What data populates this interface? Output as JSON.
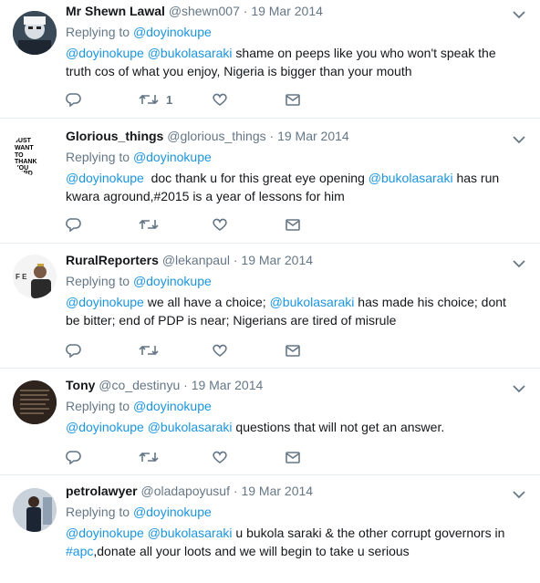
{
  "replying_prefix": "Replying to",
  "tweets": [
    {
      "name": "Mr Shewn Lawal",
      "handle": "@shewn007",
      "sep": "·",
      "date": "19 Mar 2014",
      "replying_to": "@doyinokupe",
      "parts": [
        {
          "t": "@doyinokupe",
          "k": "mention"
        },
        {
          "t": " ",
          "k": "text"
        },
        {
          "t": "@bukolasaraki",
          "k": "mention"
        },
        {
          "t": " shame on peeps like you who won't speak the truth cos of what you enjoy, Nigeria is bigger than your mouth",
          "k": "text"
        }
      ],
      "retweet_count": "1"
    },
    {
      "name": "Glorious_things",
      "handle": "@glorious_things",
      "sep": "·",
      "date": "19 Mar 2014",
      "replying_to": "@doyinokupe",
      "parts": [
        {
          "t": "@doyinokupe",
          "k": "mention"
        },
        {
          "t": "  doc thank u for this great eye opening ",
          "k": "text"
        },
        {
          "t": "@bukolasaraki",
          "k": "mention"
        },
        {
          "t": " has run kwara aground,#2015 is a year of lessons for him",
          "k": "text"
        }
      ],
      "retweet_count": "",
      "avatar_text": "JUST WANT TO THANK YOU LORD"
    },
    {
      "name": "RuralReporters",
      "handle": "@lekanpaul",
      "sep": "·",
      "date": "19 Mar 2014",
      "replying_to": "@doyinokupe",
      "parts": [
        {
          "t": "@doyinokupe",
          "k": "mention"
        },
        {
          "t": " we all have a choice; ",
          "k": "text"
        },
        {
          "t": "@bukolasaraki",
          "k": "mention"
        },
        {
          "t": " has made his choice; dont be bitter; end of PDP is near; Nigerians are tired of misrule",
          "k": "text"
        }
      ],
      "retweet_count": "",
      "avatar_text": "F E"
    },
    {
      "name": "Tony",
      "handle": "@co_destinyu",
      "sep": "·",
      "date": "19 Mar 2014",
      "replying_to": "@doyinokupe",
      "parts": [
        {
          "t": "@doyinokupe",
          "k": "mention"
        },
        {
          "t": " ",
          "k": "text"
        },
        {
          "t": "@bukolasaraki",
          "k": "mention"
        },
        {
          "t": " questions that will not get an answer.",
          "k": "text"
        }
      ],
      "retweet_count": ""
    },
    {
      "name": "petrolawyer",
      "handle": "@oladapoyusuf",
      "sep": "·",
      "date": "19 Mar 2014",
      "replying_to": "@doyinokupe",
      "parts": [
        {
          "t": "@doyinokupe",
          "k": "mention"
        },
        {
          "t": " ",
          "k": "text"
        },
        {
          "t": "@bukolasaraki",
          "k": "mention"
        },
        {
          "t": " u bukola saraki & the other corrupt governors in ",
          "k": "text"
        },
        {
          "t": "#apc",
          "k": "hashtag"
        },
        {
          "t": ",donate all your loots and we will begin to take u serious",
          "k": "text"
        }
      ],
      "retweet_count": ""
    }
  ],
  "icons": {
    "reply": "reply-icon",
    "retweet": "retweet-icon",
    "like": "heart-icon",
    "dm": "envelope-icon",
    "more": "chevron-down-icon"
  },
  "colors": {
    "link": "#1b95e0",
    "secondary": "#657786",
    "divider": "#e6ecf0",
    "text": "#14171a"
  }
}
